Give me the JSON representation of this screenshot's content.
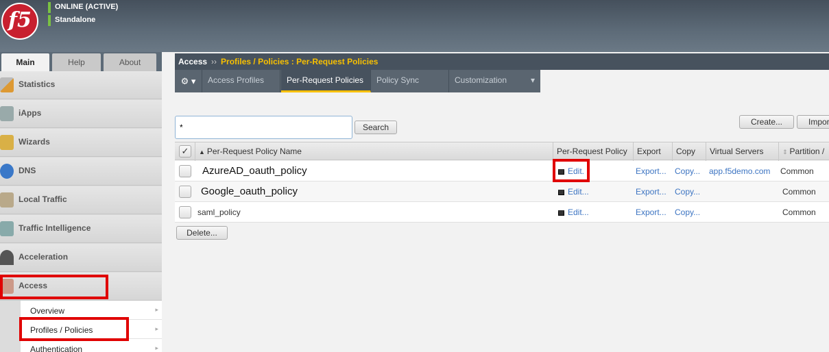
{
  "header": {
    "logo_text": "f5",
    "status_line1": "ONLINE (ACTIVE)",
    "status_line2": "Standalone"
  },
  "left_tabs": [
    "Main",
    "Help",
    "About"
  ],
  "sidebar": {
    "items": [
      {
        "label": "Statistics",
        "icon": "statistics-icon"
      },
      {
        "label": "iApps",
        "icon": "iapps-icon"
      },
      {
        "label": "Wizards",
        "icon": "wizards-icon"
      },
      {
        "label": "DNS",
        "icon": "dns-icon"
      },
      {
        "label": "Local Traffic",
        "icon": "local-traffic-icon"
      },
      {
        "label": "Traffic Intelligence",
        "icon": "traffic-intelligence-icon"
      },
      {
        "label": "Acceleration",
        "icon": "acceleration-icon"
      },
      {
        "label": "Access",
        "icon": "access-icon"
      }
    ],
    "submenu": [
      "Overview",
      "Profiles / Policies",
      "Authentication"
    ]
  },
  "breadcrumb": {
    "root": "Access",
    "separator": "››",
    "path": "Profiles / Policies : Per-Request Policies"
  },
  "toolbar": {
    "gear": "⚙ ▾",
    "tabs": [
      "Access Profiles",
      "Per-Request Policies",
      "Policy Sync",
      "Customization"
    ],
    "dropdown_arrow": "▾"
  },
  "search": {
    "value": "*",
    "button": "Search"
  },
  "actions": {
    "create": "Create...",
    "import": "Impor"
  },
  "table": {
    "columns": [
      "Per-Request Policy Name",
      "Per-Request Policy",
      "Export",
      "Copy",
      "Virtual Servers",
      "Partition /"
    ],
    "rows": [
      {
        "name": "AzureAD_oauth_policy",
        "edit": "Edit.",
        "export": "Export...",
        "copy": "Copy...",
        "virtual_servers": "app.f5demo.com",
        "partition": "Common"
      },
      {
        "name": "Google_oauth_policy",
        "edit": "Edit...",
        "export": "Export...",
        "copy": "Copy...",
        "virtual_servers": "",
        "partition": "Common"
      },
      {
        "name": "saml_policy",
        "edit": "Edit...",
        "export": "Export...",
        "copy": "Copy...",
        "virtual_servers": "",
        "partition": "Common"
      }
    ],
    "delete_button": "Delete..."
  },
  "colors": {
    "highlight": "#e00000",
    "accent": "#f8c000",
    "link": "#3c74c2"
  }
}
